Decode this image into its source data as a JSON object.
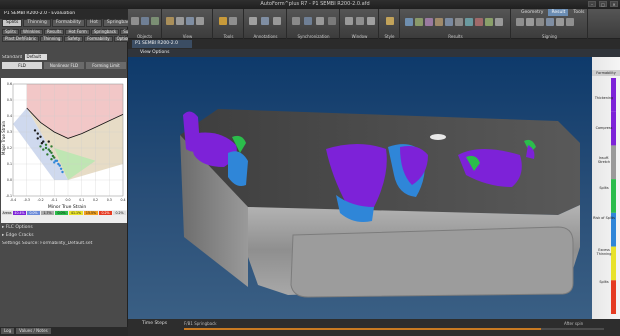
{
  "window": {
    "title": "AutoForm^plus R7 - P1 SEMBI R200-2.0.afd",
    "controls": [
      "–",
      "□",
      "✕"
    ]
  },
  "left_panel": {
    "header": "P1 SEMBI R200-2.0 - Evaluation",
    "tabs": [
      "Splits",
      "Thinning",
      "Formability",
      "Hot",
      "Springback",
      "Surface"
    ],
    "tool_rows": [
      [
        "Splits",
        "Wrinkles",
        "Results",
        "Hot Form",
        "Springback",
        "Surfaces"
      ],
      [
        "Plast Def/Fabric",
        "Thinning",
        "Safety",
        "Formability",
        "Options"
      ]
    ],
    "standard_label": "Standard",
    "standard_value": "Default",
    "sub_tabs": [
      "FLD",
      "Nonlinear FLD",
      "Forming Limit"
    ],
    "active_sub_tab": 0,
    "chart_xlabel": "Minor True Strain",
    "chart_ylabel": "Major True Strain",
    "legend_values": [
      "Areas",
      "40.4%",
      "0.0%",
      "1.7%",
      "0.0%",
      "41.1%",
      "15.5%",
      "0.2%",
      "0.2%"
    ],
    "sections": [
      "FLC Options",
      "Edge Cracks"
    ],
    "settings_source_label": "Settings Source:",
    "settings_source_value": "Formability_Default.set",
    "bottom_tabs": [
      "Log",
      "Values / Notes"
    ]
  },
  "ribbon": {
    "tabs": [
      "Geometry",
      "Result",
      "Tools"
    ],
    "active_tab": 1,
    "groups": [
      "Objects",
      "View",
      "Tools",
      "Annotations",
      "Synchronization",
      "Window",
      "Style",
      "Results",
      "Signing"
    ]
  },
  "viewport": {
    "doc_tab": "P1 SEMBI R200-2.0",
    "view_options": "View Options"
  },
  "result_legend": {
    "title": "Formability",
    "labels": [
      "Thickening",
      "Compress",
      "Insuff. Stretch",
      "Splits",
      "Risk of Splits",
      "Excess Thinning",
      "Splits"
    ],
    "colors": [
      "#7d22d8",
      "#7d22d8",
      "#9a9a9a",
      "#2bbd4b",
      "#2f86d8",
      "#e8e22a",
      "#e53b22"
    ]
  },
  "timeline": {
    "label": "Time Steps",
    "step_text": "F/B1 Springback",
    "after_text": "After spin",
    "progress_fraction": 0.85
  },
  "chart_data": {
    "type": "scatter",
    "title": "",
    "xlabel": "Minor True Strain",
    "ylabel": "Major True Strain",
    "xlim": [
      -0.4,
      0.4
    ],
    "ylim": [
      -0.1,
      0.6
    ],
    "xticks": [
      "-0.4",
      "-0.3",
      "-0.2",
      "-0.1",
      "0.0",
      "0.1",
      "0.2",
      "0.3",
      "0.4"
    ],
    "yticks": [
      "0.6",
      "0.5",
      "0.4",
      "0.3",
      "0.2",
      "0.1",
      "0.0",
      "-0.1"
    ],
    "flc_curve": {
      "x": [
        -0.3,
        -0.2,
        -0.1,
        0.0,
        0.1,
        0.2,
        0.3,
        0.4
      ],
      "y": [
        0.45,
        0.36,
        0.3,
        0.26,
        0.29,
        0.33,
        0.37,
        0.41
      ]
    },
    "series": [
      {
        "name": "",
        "x": [
          -0.24,
          -0.22,
          -0.2,
          -0.18,
          -0.16,
          -0.14,
          -0.12,
          -0.1,
          -0.08,
          -0.06,
          -0.2,
          -0.18,
          -0.15,
          -0.12,
          -0.1,
          -0.22,
          -0.19,
          -0.16,
          -0.13,
          -0.11,
          -0.09,
          -0.07,
          -0.05,
          -0.04,
          -0.14,
          -0.12
        ],
        "y": [
          0.31,
          0.29,
          0.27,
          0.24,
          0.22,
          0.19,
          0.17,
          0.14,
          0.12,
          0.09,
          0.21,
          0.19,
          0.16,
          0.13,
          0.11,
          0.26,
          0.23,
          0.2,
          0.18,
          0.15,
          0.12,
          0.1,
          0.07,
          0.05,
          0.24,
          0.21
        ]
      }
    ]
  }
}
